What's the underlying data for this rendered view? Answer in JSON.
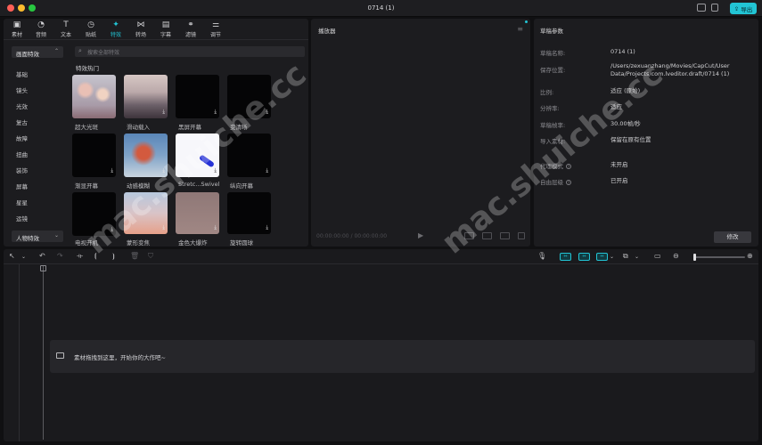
{
  "window": {
    "title": "0714 (1)",
    "export_label": "导出"
  },
  "toolbar_tabs": [
    {
      "label": "素材",
      "icon": "media-icon"
    },
    {
      "label": "音频",
      "icon": "audio-icon"
    },
    {
      "label": "文本",
      "icon": "text-icon"
    },
    {
      "label": "贴纸",
      "icon": "sticker-icon"
    },
    {
      "label": "特效",
      "icon": "effects-icon"
    },
    {
      "label": "转场",
      "icon": "transition-icon"
    },
    {
      "label": "字幕",
      "icon": "caption-icon"
    },
    {
      "label": "滤镜",
      "icon": "filter-icon"
    },
    {
      "label": "调节",
      "icon": "adjust-icon"
    }
  ],
  "sidebar": {
    "selected": "画面特效",
    "items": [
      "基础",
      "镜头",
      "光效",
      "复古",
      "故障",
      "扭曲",
      "装饰",
      "屏幕",
      "星星",
      "运镜"
    ],
    "bottom_selected": "人物特效"
  },
  "search": {
    "placeholder": "搜索全部特效"
  },
  "effects": {
    "section_title": "特效热门",
    "tiles": [
      {
        "label": "超大光斑",
        "download": false
      },
      {
        "label": "滑动载入",
        "download": true
      },
      {
        "label": "黑屏开幕",
        "download": true
      },
      {
        "label": "变清晰",
        "download": true
      },
      {
        "label": "渐显开幕",
        "download": true
      },
      {
        "label": "动感模糊",
        "download": true
      },
      {
        "label": "Stretc...Swivel",
        "download": true
      },
      {
        "label": "纵向开幕",
        "download": true
      },
      {
        "label": "电视开机",
        "download": true
      },
      {
        "label": "蒙形变焦",
        "download": true
      },
      {
        "label": "金色大爆炸",
        "download": true
      },
      {
        "label": "旋转圆球",
        "download": true
      }
    ]
  },
  "player": {
    "title": "播放器",
    "time": "00:00:00:00 / 00:00:00:00"
  },
  "draft": {
    "title": "草稿参数",
    "rows": [
      {
        "key": "草稿名称:",
        "value": "0714 (1)",
        "help": false
      },
      {
        "key": "保存位置:",
        "value": "/Users/zexuanzhang/Movies/CapCut/User Data/Projects/com.lveditor.draft/0714 (1)",
        "help": false
      },
      {
        "key": "比例:",
        "value": "适应 (原始)",
        "help": false
      },
      {
        "key": "分辨率:",
        "value": "适应",
        "help": false
      },
      {
        "key": "草稿帧率:",
        "value": "30.00帧/秒",
        "help": false
      },
      {
        "key": "导入素材:",
        "value": "保留在原有位置",
        "help": false
      },
      {
        "key": "代理模式",
        "value": "未开启",
        "help": true
      },
      {
        "key": "自由层级",
        "value": "已开启",
        "help": true
      }
    ],
    "edit_label": "修改"
  },
  "timeline": {
    "drop_hint": "素材拖拽到这里，开始你的大作吧~"
  },
  "watermark": {
    "text": "mac.shuiche.cc"
  },
  "colors": {
    "accent": "#22c4d4",
    "panel": "#1c1c1f",
    "background": "#101012"
  }
}
